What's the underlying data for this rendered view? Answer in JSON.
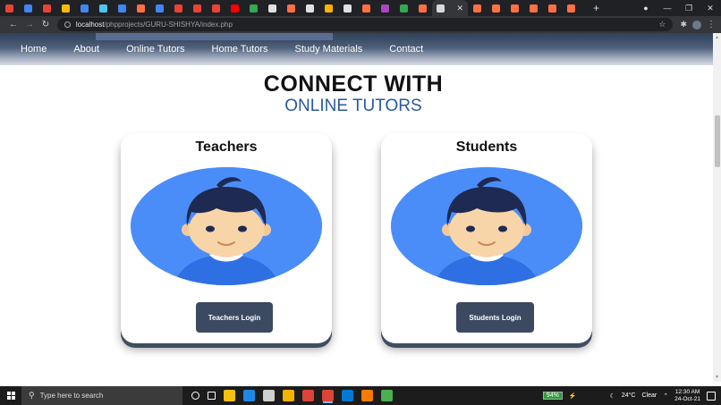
{
  "browser": {
    "tab_colors": [
      "#ea4335",
      "#4285f4",
      "#ea4335",
      "#fbbc04",
      "#4285f4",
      "#4fc3f7",
      "#4285f4",
      "#ff7043",
      "#4285f4",
      "#ea4335",
      "#ea4335",
      "#ea4335",
      "#ff0000",
      "#34a853",
      "#e0e0e0",
      "#ff7043",
      "#e0e0e0",
      "#ffb300",
      "#e0e0e0",
      "#ff7043",
      "#ab47bc",
      "#34a853",
      "#ff7043"
    ],
    "active_tab_close": "✕",
    "tab_colors_after": [
      "#ff7043",
      "#ff7043",
      "#ff7043",
      "#ff7043",
      "#ff7043",
      "#ff7043"
    ],
    "new_tab": "+",
    "window_controls": [
      "●",
      "—",
      "❐",
      "✕"
    ],
    "url_host": "localhost",
    "url_path": "/phpprojects/GURU-SHISHYA/index.php"
  },
  "nav": {
    "items": [
      "Home",
      "About",
      "Online Tutors",
      "Home Tutors",
      "Study Materials",
      "Contact"
    ]
  },
  "page": {
    "headline": "CONNECT WITH",
    "subheadline": "ONLINE TUTORS",
    "cards": [
      {
        "title": "Teachers",
        "button": "Teachers Login"
      },
      {
        "title": "Students",
        "button": "Students Login"
      }
    ]
  },
  "taskbar": {
    "search_placeholder": "Type here to search",
    "pinned_icon_colors": [
      "#ffffff",
      "#ffffff",
      "#f4c20d",
      "#1e88e5",
      "#cfcfcf",
      "#f4b400",
      "#db4437",
      "#db4437",
      "#0078d4",
      "#f57c00",
      "#4caf50"
    ],
    "battery": "94%",
    "weather_temp": "24°C",
    "weather_text": "Clear",
    "time": "12:30 AM",
    "date": "24-Oct-21"
  },
  "colors": {
    "avatar_bg": "#4b8df8",
    "button_bg": "#3b4a61",
    "subheadline": "#2a5a9a"
  }
}
